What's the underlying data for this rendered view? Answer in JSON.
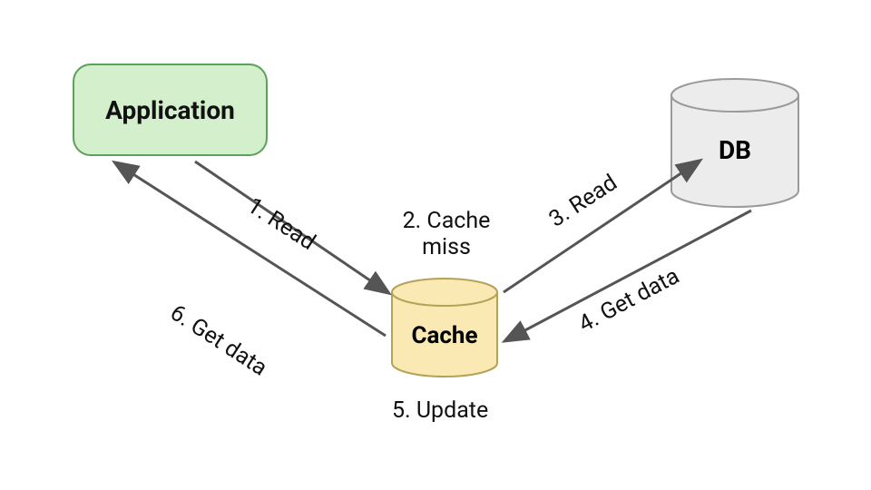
{
  "nodes": {
    "application": {
      "label": "Application",
      "fill": "#d4efcc",
      "stroke": "#5aa15a"
    },
    "cache": {
      "label": "Cache",
      "fill": "#fbe9b3",
      "stroke": "#b3a35a"
    },
    "db": {
      "label": "DB",
      "fill": "#ececec",
      "stroke": "#9a9a9a"
    }
  },
  "steps": {
    "s1": "1. Read",
    "s2": "2. Cache miss",
    "s3": "3. Read",
    "s4": "4. Get data",
    "s5": "5. Update",
    "s6": "6. Get data"
  },
  "arrow_color": "#555555"
}
